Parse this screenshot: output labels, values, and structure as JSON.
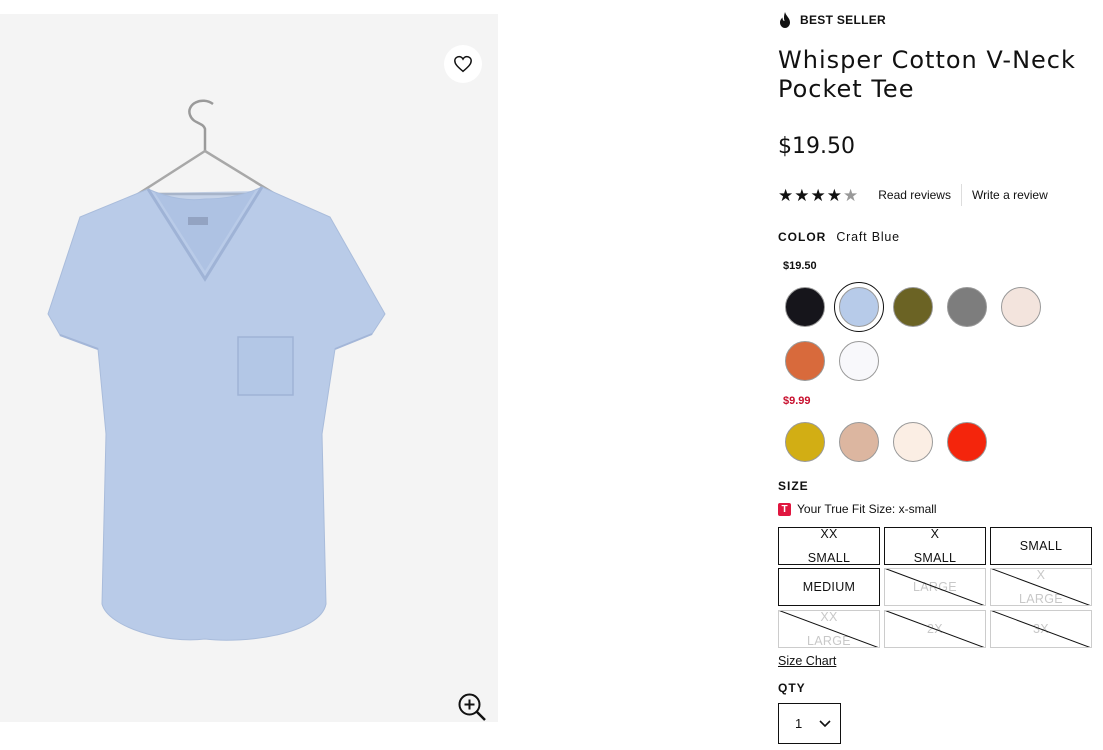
{
  "product": {
    "badge": "BEST SELLER",
    "title": "Whisper Cotton V-Neck Pocket Tee",
    "price": "$19.50",
    "rating": 4,
    "rating_max": 5
  },
  "reviews": {
    "read": "Read reviews",
    "write": "Write a review"
  },
  "color": {
    "label": "COLOR",
    "selected": "Craft Blue",
    "groups": [
      {
        "price": "$19.50",
        "price_color": "#111111",
        "swatches": [
          "#16151b",
          "#b7cbe9",
          "#6b6324",
          "#7d7d7d",
          "#f3e4dd",
          "#d86a3c",
          "#f8f8fb"
        ]
      },
      {
        "price": "$9.99",
        "price_color": "#c8102e",
        "swatches": [
          "#d2ae14",
          "#dcb6a0",
          "#fbeee4",
          "#f4250c"
        ]
      }
    ]
  },
  "size": {
    "label": "SIZE",
    "true_fit_badge": "T",
    "true_fit": "Your True Fit Size: x-small",
    "options": [
      {
        "line1": "XX",
        "line2": "SMALL",
        "available": true
      },
      {
        "line1": "X",
        "line2": "SMALL",
        "available": true
      },
      {
        "line1": "SMALL",
        "line2": "",
        "available": true
      },
      {
        "line1": "MEDIUM",
        "line2": "",
        "available": true
      },
      {
        "line1": "LARGE",
        "line2": "",
        "available": false
      },
      {
        "line1": "X",
        "line2": "LARGE",
        "available": false
      },
      {
        "line1": "XX",
        "line2": "LARGE",
        "available": false
      },
      {
        "line1": "2X",
        "line2": "",
        "available": false
      },
      {
        "line1": "3X",
        "line2": "",
        "available": false
      }
    ],
    "chart_link": "Size Chart"
  },
  "qty": {
    "label": "QTY",
    "value": "1"
  },
  "icons": {
    "favorite": "heart-icon",
    "zoom": "zoom-in-icon",
    "bestseller": "flame-icon",
    "qty_dropdown": "chevron-down-icon"
  },
  "colors": {
    "tee": "#b9cbe8",
    "image_bg": "#f4f4f4",
    "sale_price": "#c8102e"
  }
}
